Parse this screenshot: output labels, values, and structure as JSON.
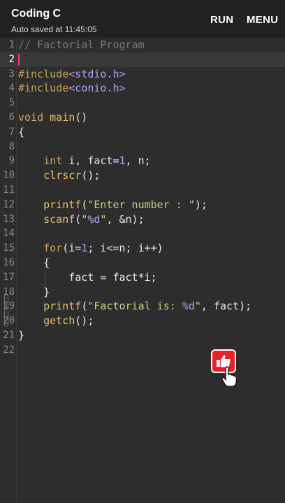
{
  "appbar": {
    "title": "Coding C",
    "subtitle": "Auto saved at 11:45:05",
    "run_label": "RUN",
    "menu_label": "MENU"
  },
  "editor": {
    "lines": [
      {
        "n": "1",
        "tokens": [
          [
            "c-comment",
            "// Factorial Program"
          ]
        ]
      },
      {
        "n": "2",
        "tokens": []
      },
      {
        "n": "3",
        "tokens": [
          [
            "c-pre",
            "#include"
          ],
          [
            "c-hdr",
            "<stdio.h>"
          ]
        ]
      },
      {
        "n": "4",
        "tokens": [
          [
            "c-pre",
            "#include"
          ],
          [
            "c-hdr",
            "<conio.h>"
          ]
        ]
      },
      {
        "n": "5",
        "tokens": []
      },
      {
        "n": "6",
        "tokens": [
          [
            "c-kw",
            "void"
          ],
          [
            "c-txt",
            " "
          ],
          [
            "c-fn",
            "main"
          ],
          [
            "c-txt",
            "()"
          ]
        ]
      },
      {
        "n": "7",
        "tokens": [
          [
            "c-txt",
            "{"
          ]
        ]
      },
      {
        "n": "8",
        "tokens": []
      },
      {
        "n": "9",
        "tokens": [
          [
            "c-txt",
            "    "
          ],
          [
            "c-kw",
            "int"
          ],
          [
            "c-txt",
            " i, fact="
          ],
          [
            "c-num",
            "1"
          ],
          [
            "c-txt",
            ", n;"
          ]
        ]
      },
      {
        "n": "10",
        "tokens": [
          [
            "c-txt",
            "    "
          ],
          [
            "c-fn",
            "clrscr"
          ],
          [
            "c-txt",
            "();"
          ]
        ]
      },
      {
        "n": "11",
        "tokens": []
      },
      {
        "n": "12",
        "tokens": [
          [
            "c-txt",
            "    "
          ],
          [
            "c-fn",
            "printf"
          ],
          [
            "c-txt",
            "("
          ],
          [
            "c-str",
            "\"Enter number : \""
          ],
          [
            "c-txt",
            ");"
          ]
        ]
      },
      {
        "n": "13",
        "tokens": [
          [
            "c-txt",
            "    "
          ],
          [
            "c-fn",
            "scanf"
          ],
          [
            "c-txt",
            "("
          ],
          [
            "c-str",
            "\""
          ],
          [
            "c-fmt",
            "%d"
          ],
          [
            "c-str",
            "\""
          ],
          [
            "c-txt",
            ", &n);"
          ]
        ]
      },
      {
        "n": "14",
        "tokens": []
      },
      {
        "n": "15",
        "tokens": [
          [
            "c-txt",
            "    "
          ],
          [
            "c-kw",
            "for"
          ],
          [
            "c-txt",
            "(i="
          ],
          [
            "c-num",
            "1"
          ],
          [
            "c-txt",
            "; i<=n; i++)"
          ]
        ]
      },
      {
        "n": "16",
        "tokens": [
          [
            "c-txt",
            "    {"
          ]
        ]
      },
      {
        "n": "17",
        "tokens": [
          [
            "c-txt",
            "        fact = fact*i;"
          ]
        ]
      },
      {
        "n": "18",
        "tokens": [
          [
            "c-txt",
            "    }"
          ]
        ]
      },
      {
        "n": "19",
        "tokens": [
          [
            "c-txt",
            "    "
          ],
          [
            "c-fn",
            "printf"
          ],
          [
            "c-txt",
            "("
          ],
          [
            "c-str",
            "\"Factorial is: "
          ],
          [
            "c-fmt",
            "%d"
          ],
          [
            "c-str",
            "\""
          ],
          [
            "c-txt",
            ", fact);"
          ]
        ]
      },
      {
        "n": "20",
        "tokens": [
          [
            "c-txt",
            "    "
          ],
          [
            "c-fn",
            "getch"
          ],
          [
            "c-txt",
            "();"
          ]
        ]
      },
      {
        "n": "21",
        "tokens": [
          [
            "c-txt",
            "}"
          ]
        ]
      },
      {
        "n": "22",
        "tokens": []
      }
    ],
    "active_line": 2
  },
  "icons": {
    "like": "thumbs-up-icon",
    "pointer": "hand-pointer-icon"
  },
  "colors": {
    "like_red": "#e8202a",
    "cursor": "#ff3366"
  }
}
